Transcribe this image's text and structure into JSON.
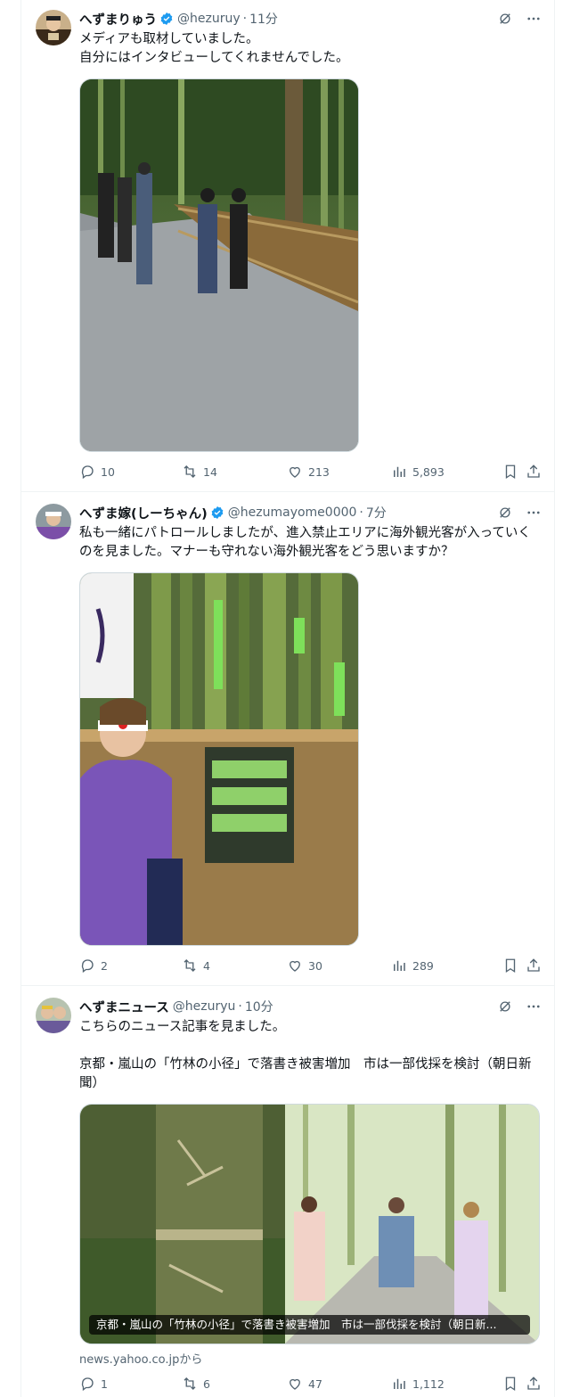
{
  "tweets": [
    {
      "name": "へずまりゅう",
      "handle": "@hezuruy",
      "time": "11分",
      "text": "メディアも取材していました。\n自分にはインタビューしてくれませんでした。",
      "media_icon": "photo-bamboo-path-film-crew",
      "stats": {
        "reply": "10",
        "retweet": "14",
        "like": "213",
        "views": "5,893"
      }
    },
    {
      "name": "へずま嫁(しーちゃん)",
      "handle": "@hezumayome0000",
      "time": "7分",
      "text": "私も一緒にパトロールしましたが、進入禁止エリアに海外観光客が入っていくのを見ました。マナーも守れない海外観光客をどう思いますか？",
      "media_icon": "photo-woman-pointing-at-sign",
      "stats": {
        "reply": "2",
        "retweet": "4",
        "like": "30",
        "views": "289"
      }
    },
    {
      "name": "へずまニュース",
      "handle": "@hezuryu",
      "time": "10分",
      "text": "こちらのニュース記事を見ました。\n\n京都・嵐山の「竹林の小径」で落書き被害増加　市は一部伐採を検討（朝日新聞）",
      "card_title": "京都・嵐山の「竹林の小径」で落書き被害増加　市は一部伐採を検討（朝日新...",
      "card_source": "news.yahoo.co.jpから",
      "media_icon": "photo-carved-bamboo-and-tourists",
      "stats": {
        "reply": "1",
        "retweet": "6",
        "like": "47",
        "views": "1,112"
      }
    }
  ],
  "colors": {
    "text": "#0f1419",
    "muted": "#536471",
    "verified": "#1d9bf0",
    "border": "#eff3f4"
  }
}
